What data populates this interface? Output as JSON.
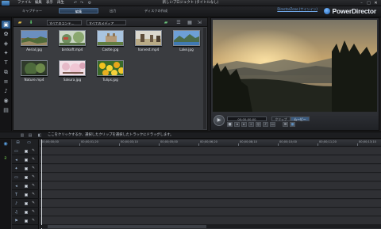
{
  "menubar": {
    "items": [
      "ファイル",
      "編集",
      "表示",
      "再生",
      "⚙"
    ],
    "title": "新しいプロジェクト (タイトルなし)"
  },
  "header": {
    "tabs": [
      "キャプチャー",
      "編集",
      "出力",
      "ディスクの作成"
    ],
    "active_tab": "編集",
    "upgrade_link": "DirectorZone (サインイン)",
    "brand": "PowerDirector"
  },
  "library": {
    "filter_content": "すべてのコンテ…",
    "filter_media": "すべてのメディア",
    "items": [
      {
        "name": "Aerial.jpg"
      },
      {
        "name": "birdsoft.mp4"
      },
      {
        "name": "Castle.jpg"
      },
      {
        "name": "harvest.mp4"
      },
      {
        "name": "Lake.jpg"
      },
      {
        "name": "Nature.mp4"
      },
      {
        "name": "Sakura.jpg"
      },
      {
        "name": "Tulips.jpg"
      }
    ]
  },
  "preview": {
    "timecode": "00;00;00;00",
    "mode_clip": "クリップ",
    "mode_movie": "ムービー"
  },
  "hint": {
    "text": "ここをクリックするか、選択したクリップを選択したトラックにドラッグします。"
  },
  "timeline": {
    "ruler": [
      "00;00;00;00",
      "00;00;01;20",
      "00;00;03;10",
      "00;00;05;00",
      "00;00;06;20",
      "00;00;08;10",
      "00;00;10;00",
      "00;00;11;20",
      "00;00;13;10"
    ]
  }
}
